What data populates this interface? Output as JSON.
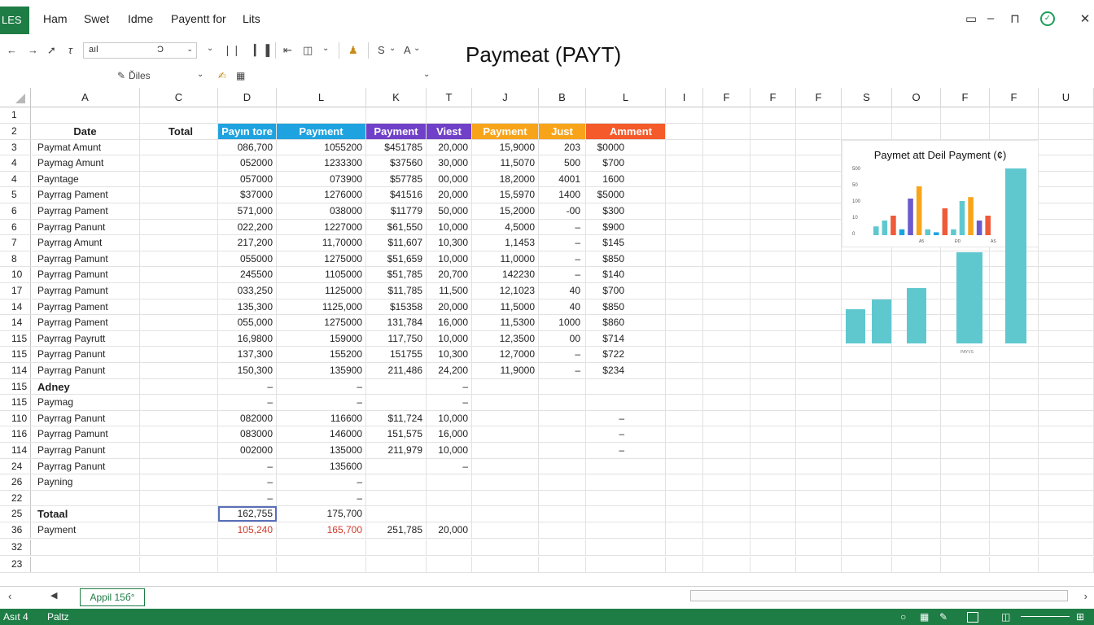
{
  "app": {
    "badge": "LES",
    "tabs": [
      "Ham",
      "Swet",
      "Idme",
      "Payentt for",
      "Lits"
    ],
    "title": "Paymeat (PAYT)"
  },
  "toolbar": {
    "font_box": "aıl",
    "format_box": "Ͻ",
    "styles_label": "Ďiles"
  },
  "columns": [
    "A",
    "C",
    "D",
    "L",
    "K",
    "T",
    "J",
    "B",
    "L",
    "I",
    "F",
    "F",
    "F",
    "S",
    "O",
    "F",
    "F",
    "U"
  ],
  "headers": {
    "row_label": "2",
    "date": "Date",
    "total": "Total",
    "d": "Payın tore",
    "l": "Payment",
    "k": "Payment",
    "t": "Viest",
    "j": "Payment",
    "b": "Just",
    "l2": "Amment"
  },
  "rows": [
    {
      "rh": "1",
      "a": "",
      "d": "",
      "l": "",
      "k": "",
      "t": "",
      "j": "",
      "b": "",
      "l2": ""
    },
    {
      "rh": "3",
      "a": "Paymat Amunt",
      "d": "086,700",
      "l": "1055200",
      "k": "$451785",
      "t": "20,000",
      "j": "15,9000",
      "b": "203",
      "l2": "$0000"
    },
    {
      "rh": "4",
      "a": "Paymag Amunt",
      "d": "052000",
      "l": "1233300",
      "k": "$37560",
      "t": "30,000",
      "j": "11,5070",
      "b": "500",
      "l2": "$700"
    },
    {
      "rh": "4",
      "a": "Payntage",
      "d": "057000",
      "l": "073900",
      "k": "$57785",
      "t": "00,000",
      "j": "18,2000",
      "b": "4001",
      "l2": "1600"
    },
    {
      "rh": "5",
      "a": "Payrrag Pament",
      "d": "$37000",
      "l": "1276000",
      "k": "$41516",
      "t": "20,000",
      "j": "15,5970",
      "b": "1400",
      "l2": "$5000"
    },
    {
      "rh": "6",
      "a": "Payrrag Pament",
      "d": "571,000",
      "l": "038000",
      "k": "$11779",
      "t": "50,000",
      "j": "15,2000",
      "b": "-00",
      "l2": "$300"
    },
    {
      "rh": "6",
      "a": "Payrrag Panunt",
      "d": "022,200",
      "l": "1227000",
      "k": "$61,550",
      "t": "10,000",
      "j": "4,5000",
      "b": "–",
      "l2": "$900"
    },
    {
      "rh": "7",
      "a": "Payrrag Amunt",
      "d": "217,200",
      "l": "11,70000",
      "k": "$11,607",
      "t": "10,300",
      "j": "1,1453",
      "b": "–",
      "l2": "$145"
    },
    {
      "rh": "8",
      "a": "Payrrag Pamunt",
      "d": "055000",
      "l": "1275000",
      "k": "$51,659",
      "t": "10,000",
      "j": "11,0000",
      "b": "–",
      "l2": "$850"
    },
    {
      "rh": "10",
      "a": "Payrrag Pamunt",
      "d": "245500",
      "l": "1105000",
      "k": "$51,785",
      "t": "20,700",
      "j": "142230",
      "b": "–",
      "l2": "$140"
    },
    {
      "rh": "17",
      "a": "Payrrag Pamunt",
      "d": "033,250",
      "l": "1125000",
      "k": "$11,785",
      "t": "11,500",
      "j": "12,1023",
      "b": "40",
      "l2": "$700"
    },
    {
      "rh": "14",
      "a": "Payrrag Pament",
      "d": "135,300",
      "l": "1125,000",
      "k": "$15358",
      "t": "20,000",
      "j": "11,5000",
      "b": "40",
      "l2": "$850"
    },
    {
      "rh": "14",
      "a": "Payrrag Pament",
      "d": "055,000",
      "l": "1275000",
      "k": "131,784",
      "t": "16,000",
      "j": "11,5300",
      "b": "1000",
      "l2": "$860"
    },
    {
      "rh": "115",
      "a": "Payrrag Payrutt",
      "d": "16,9800",
      "l": "159000",
      "k": "117,750",
      "t": "10,000",
      "j": "12,3500",
      "b": "00",
      "l2": "$714"
    },
    {
      "rh": "115",
      "a": "Payrrag Panunt",
      "d": "137,300",
      "l": "155200",
      "k": "151755",
      "t": "10,300",
      "j": "12,7000",
      "b": "–",
      "l2": "$722"
    },
    {
      "rh": "114",
      "a": "Payrrag Panunt",
      "d": "150,300",
      "l": "135900",
      "k": "211,486",
      "t": "24,200",
      "j": "11,9000",
      "b": "–",
      "l2": "$234"
    },
    {
      "rh": "115",
      "a": "Adney",
      "a_bold": true,
      "d": "–",
      "l": "–",
      "k": "",
      "t": "–",
      "j": "",
      "b": "",
      "l2": ""
    },
    {
      "rh": "115",
      "a": "Paymag",
      "d": "–",
      "l": "–",
      "k": "",
      "t": "–",
      "j": "",
      "b": "",
      "l2": ""
    },
    {
      "rh": "110",
      "a": "Payrrag Panunt",
      "d": "082000",
      "l": "116600",
      "k": "$11,724",
      "t": "10,000",
      "j": "",
      "b": "",
      "l2": "–"
    },
    {
      "rh": "116",
      "a": "Payrrag Pamunt",
      "d": "083000",
      "l": "146000",
      "k": "151,575",
      "t": "16,000",
      "j": "",
      "b": "",
      "l2": "–"
    },
    {
      "rh": "114",
      "a": "Payrrag Panunt",
      "d": "002000",
      "l": "135000",
      "k": "211,979",
      "t": "10,000",
      "j": "",
      "b": "",
      "l2": "–"
    },
    {
      "rh": "24",
      "a": "Payrrag Panunt",
      "d": "–",
      "l": "135600",
      "k": "",
      "t": "–",
      "j": "",
      "b": "",
      "l2": ""
    },
    {
      "rh": "26",
      "a": "Payning",
      "d": "–",
      "l": "–",
      "k": "",
      "t": "",
      "j": "",
      "b": "",
      "l2": ""
    },
    {
      "rh": "22",
      "a": "",
      "d": "–",
      "l": "–",
      "k": "",
      "t": "",
      "j": "",
      "b": "",
      "l2": ""
    },
    {
      "rh": "25",
      "a": "Totaal",
      "a_bold": true,
      "d": "162,755",
      "l": "175,700",
      "k": "",
      "t": "",
      "j": "",
      "b": "",
      "l2": ""
    },
    {
      "rh": "36",
      "a": "Payment",
      "d": "105,240",
      "l": "165,700",
      "k": "251,785",
      "t": "20,000",
      "j": "",
      "b": "",
      "l2": "",
      "red": true
    },
    {
      "rh": "32",
      "a": "",
      "d": "",
      "l": "",
      "k": "",
      "t": "",
      "j": "",
      "b": "",
      "l2": ""
    },
    {
      "rh": "23",
      "a": "",
      "d": "",
      "l": "",
      "k": "",
      "t": "",
      "j": "",
      "b": "",
      "l2": ""
    }
  ],
  "chart_data": {
    "type": "bar",
    "title": "Paymet att Deil Payment (¢)",
    "y_ticks": [
      "500",
      "50",
      "100",
      "10",
      "0"
    ],
    "x_ticks": [
      "A5",
      "ĐD",
      "AS"
    ],
    "values": [
      18,
      30,
      40,
      12,
      75,
      100,
      12,
      6,
      55,
      12,
      70,
      78,
      30,
      40
    ],
    "colors": [
      "#5fc8cf",
      "#5fc8cf",
      "#ef5a3a",
      "#1ea3e0",
      "#6a5acd",
      "#f8a41a",
      "#5fc8cf",
      "#1ea3e0",
      "#ef5a3a",
      "#5fc8cf",
      "#5fc8cf",
      "#f8a41a",
      "#6a5acd",
      "#ef5a3a"
    ],
    "big_values": [
      42,
      54,
      68,
      0,
      112,
      215
    ],
    "big_label": "PAYVS"
  },
  "sheet": {
    "tab_label": "Appil 15б°"
  },
  "status": {
    "left": "Asıt 4",
    "mode": "Paltz"
  },
  "colors": {
    "brand_green": "#1e7d45",
    "blue": "#1ea3e0",
    "purple": "#7040c8",
    "orange": "#f8a41a",
    "red": "#f45a2a"
  }
}
